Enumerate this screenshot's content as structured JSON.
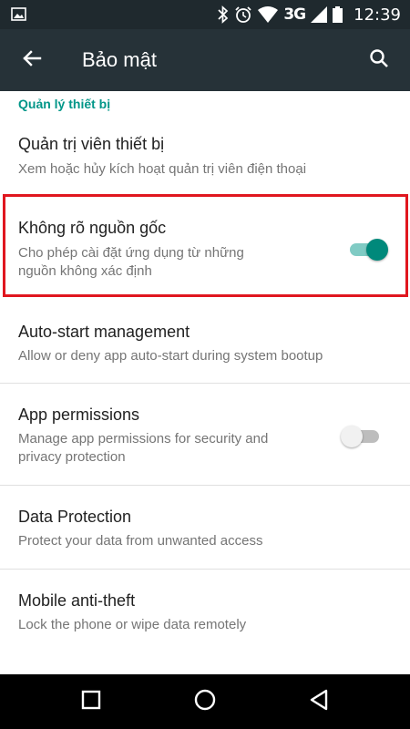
{
  "status_bar": {
    "network": "3G",
    "time": "12:39",
    "icons": [
      "image-icon",
      "bluetooth-icon",
      "alarm-icon",
      "wifi-icon",
      "signal-icon",
      "battery-icon"
    ]
  },
  "toolbar": {
    "title": "Bảo mật",
    "back_icon": "arrow-left-icon",
    "search_icon": "search-icon"
  },
  "section": {
    "header": "Quản lý thiết bị"
  },
  "items": [
    {
      "title": "Quản trị viên thiết bị",
      "subtitle": "Xem hoặc hủy kích hoạt quản trị viên điện thoại"
    },
    {
      "title": "Không rõ nguồn gốc",
      "subtitle_line1": "Cho phép cài đặt ứng dụng từ những",
      "subtitle_line2": "nguồn không xác định",
      "switch_on": true
    },
    {
      "title": "Auto-start management",
      "subtitle": "Allow or deny app auto-start during system bootup"
    },
    {
      "title": "App permissions",
      "subtitle_line1": "Manage app permissions for security and",
      "subtitle_line2": "privacy protection",
      "switch_on": false
    },
    {
      "title": "Data Protection",
      "subtitle": "Protect your data from unwanted access"
    },
    {
      "title": "Mobile anti-theft",
      "subtitle": "Lock the phone or wipe data remotely"
    }
  ],
  "nav_bar": {
    "icons": [
      "recents-square-icon",
      "home-circle-icon",
      "back-triangle-icon"
    ]
  },
  "colors": {
    "toolbar": "#263238",
    "status_bar": "#1f292e",
    "accent": "#009688",
    "highlight_border": "#e0161f"
  }
}
